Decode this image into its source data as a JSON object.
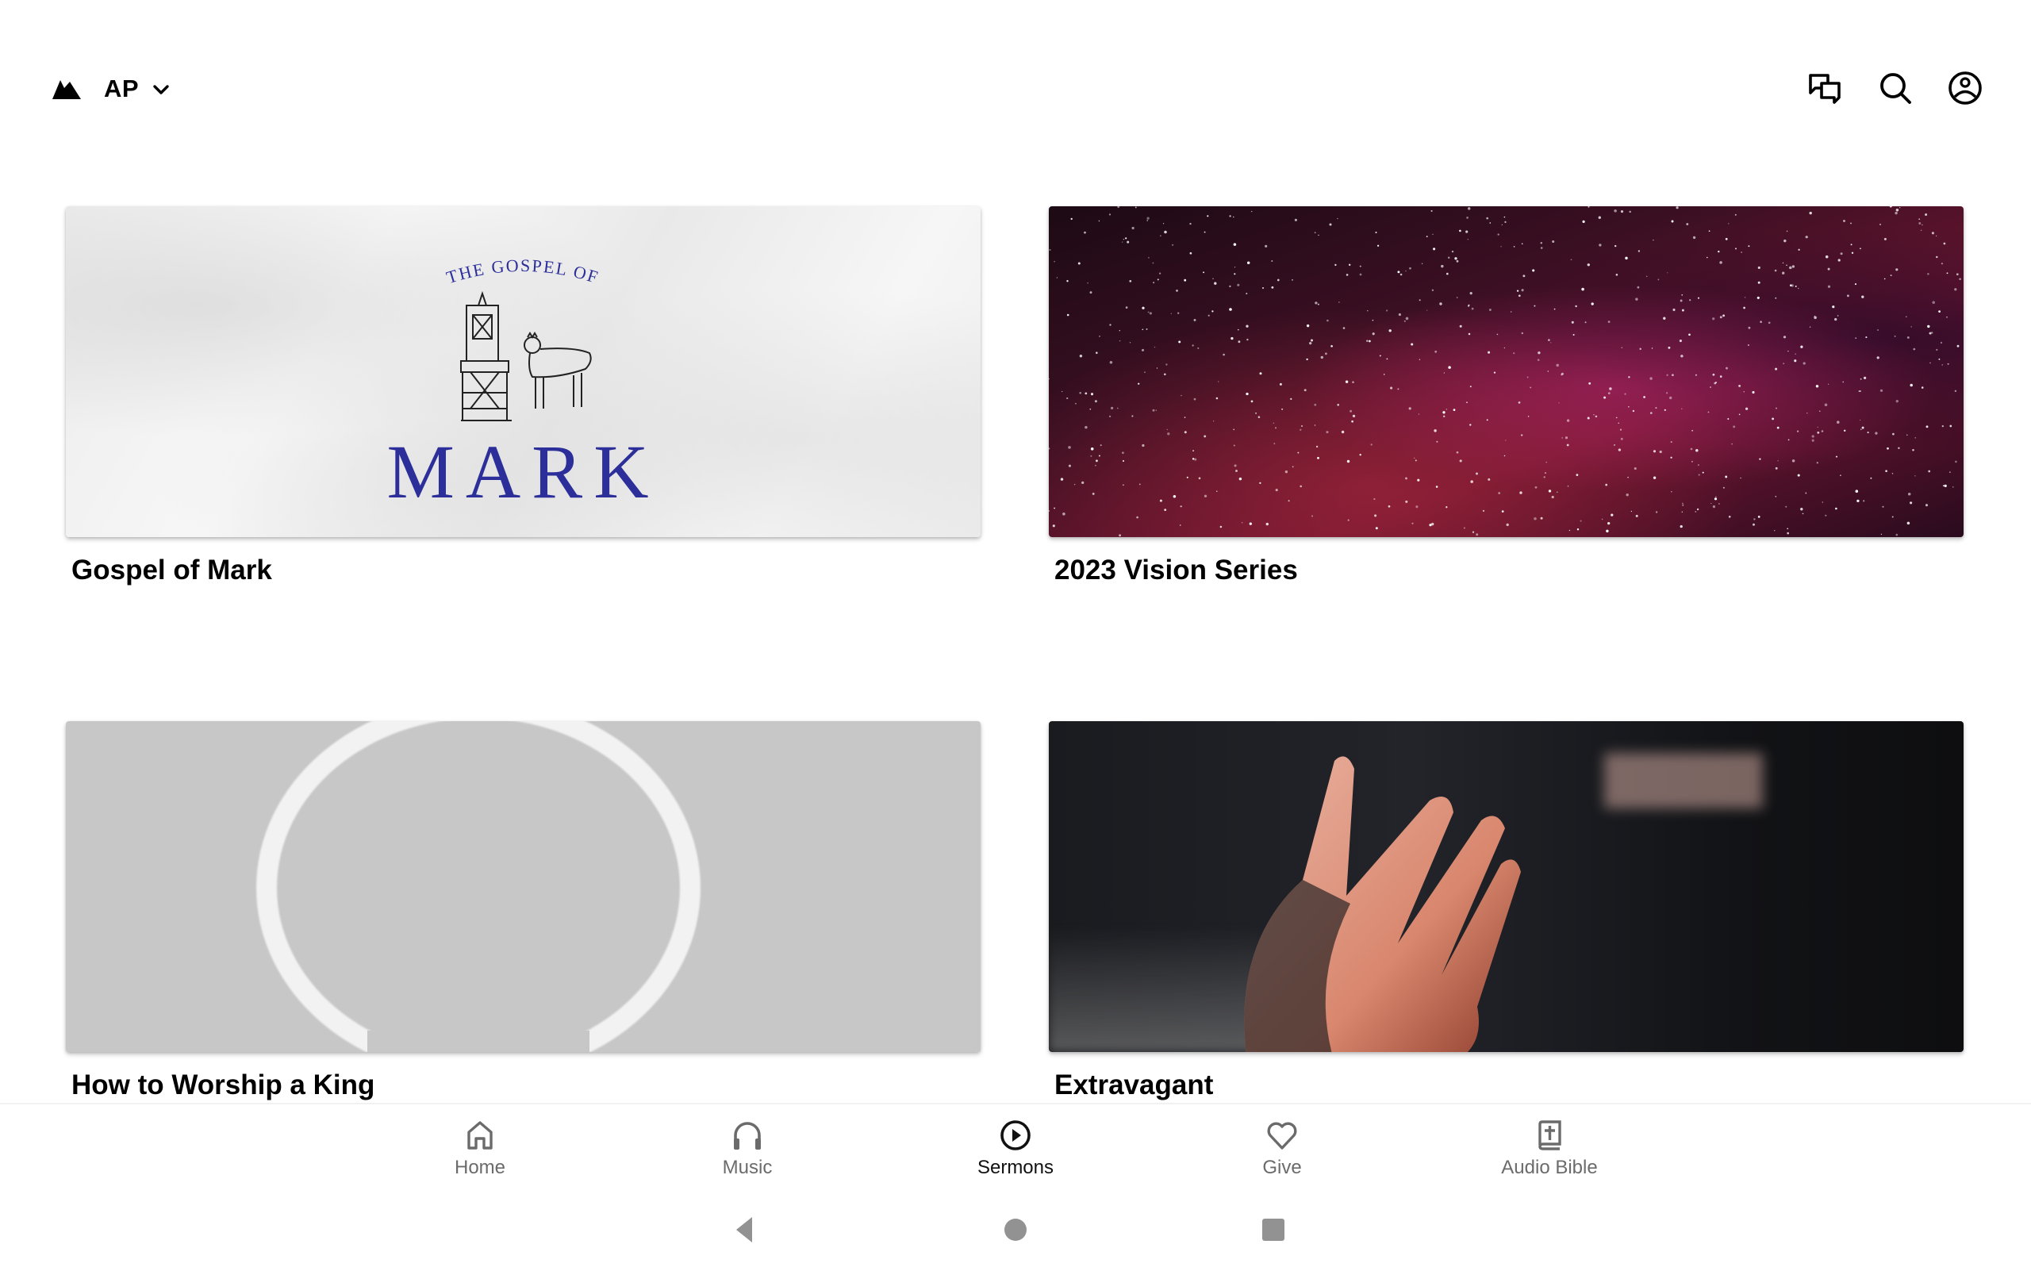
{
  "header": {
    "logo_icon": "mountain-logo-icon",
    "org_label": "AP",
    "org_dropdown_icon": "chevron-down-icon",
    "actions": [
      {
        "name": "messages",
        "icon": "chat-bubbles-icon"
      },
      {
        "name": "search",
        "icon": "search-icon"
      },
      {
        "name": "account",
        "icon": "account-circle-icon"
      }
    ]
  },
  "series": [
    {
      "title": "Gospel of Mark",
      "artwork": {
        "overline": "THE GOSPEL OF",
        "headline": "MARK",
        "accent_color": "#2c2f9a"
      }
    },
    {
      "title": "2023 Vision Series",
      "artwork": {
        "description": "starry night sky, magenta milky way"
      }
    },
    {
      "title": "How to Worship a King",
      "artwork": {
        "description": "white crown of thorns on gray"
      }
    },
    {
      "title": "Extravagant",
      "artwork": {
        "description": "open hand in light on dark background"
      }
    }
  ],
  "bottom_nav": {
    "active": "Sermons",
    "items": [
      {
        "label": "Home",
        "icon": "home-icon"
      },
      {
        "label": "Music",
        "icon": "headphones-icon"
      },
      {
        "label": "Sermons",
        "icon": "play-circle-icon"
      },
      {
        "label": "Give",
        "icon": "heart-icon"
      },
      {
        "label": "Audio Bible",
        "icon": "bible-icon"
      }
    ],
    "colors": {
      "active": "#111111",
      "inactive": "#6b6b6b"
    }
  },
  "system_nav": [
    {
      "name": "back",
      "icon": "back-triangle-icon"
    },
    {
      "name": "home",
      "icon": "home-circle-icon"
    },
    {
      "name": "recents",
      "icon": "recents-square-icon"
    }
  ]
}
